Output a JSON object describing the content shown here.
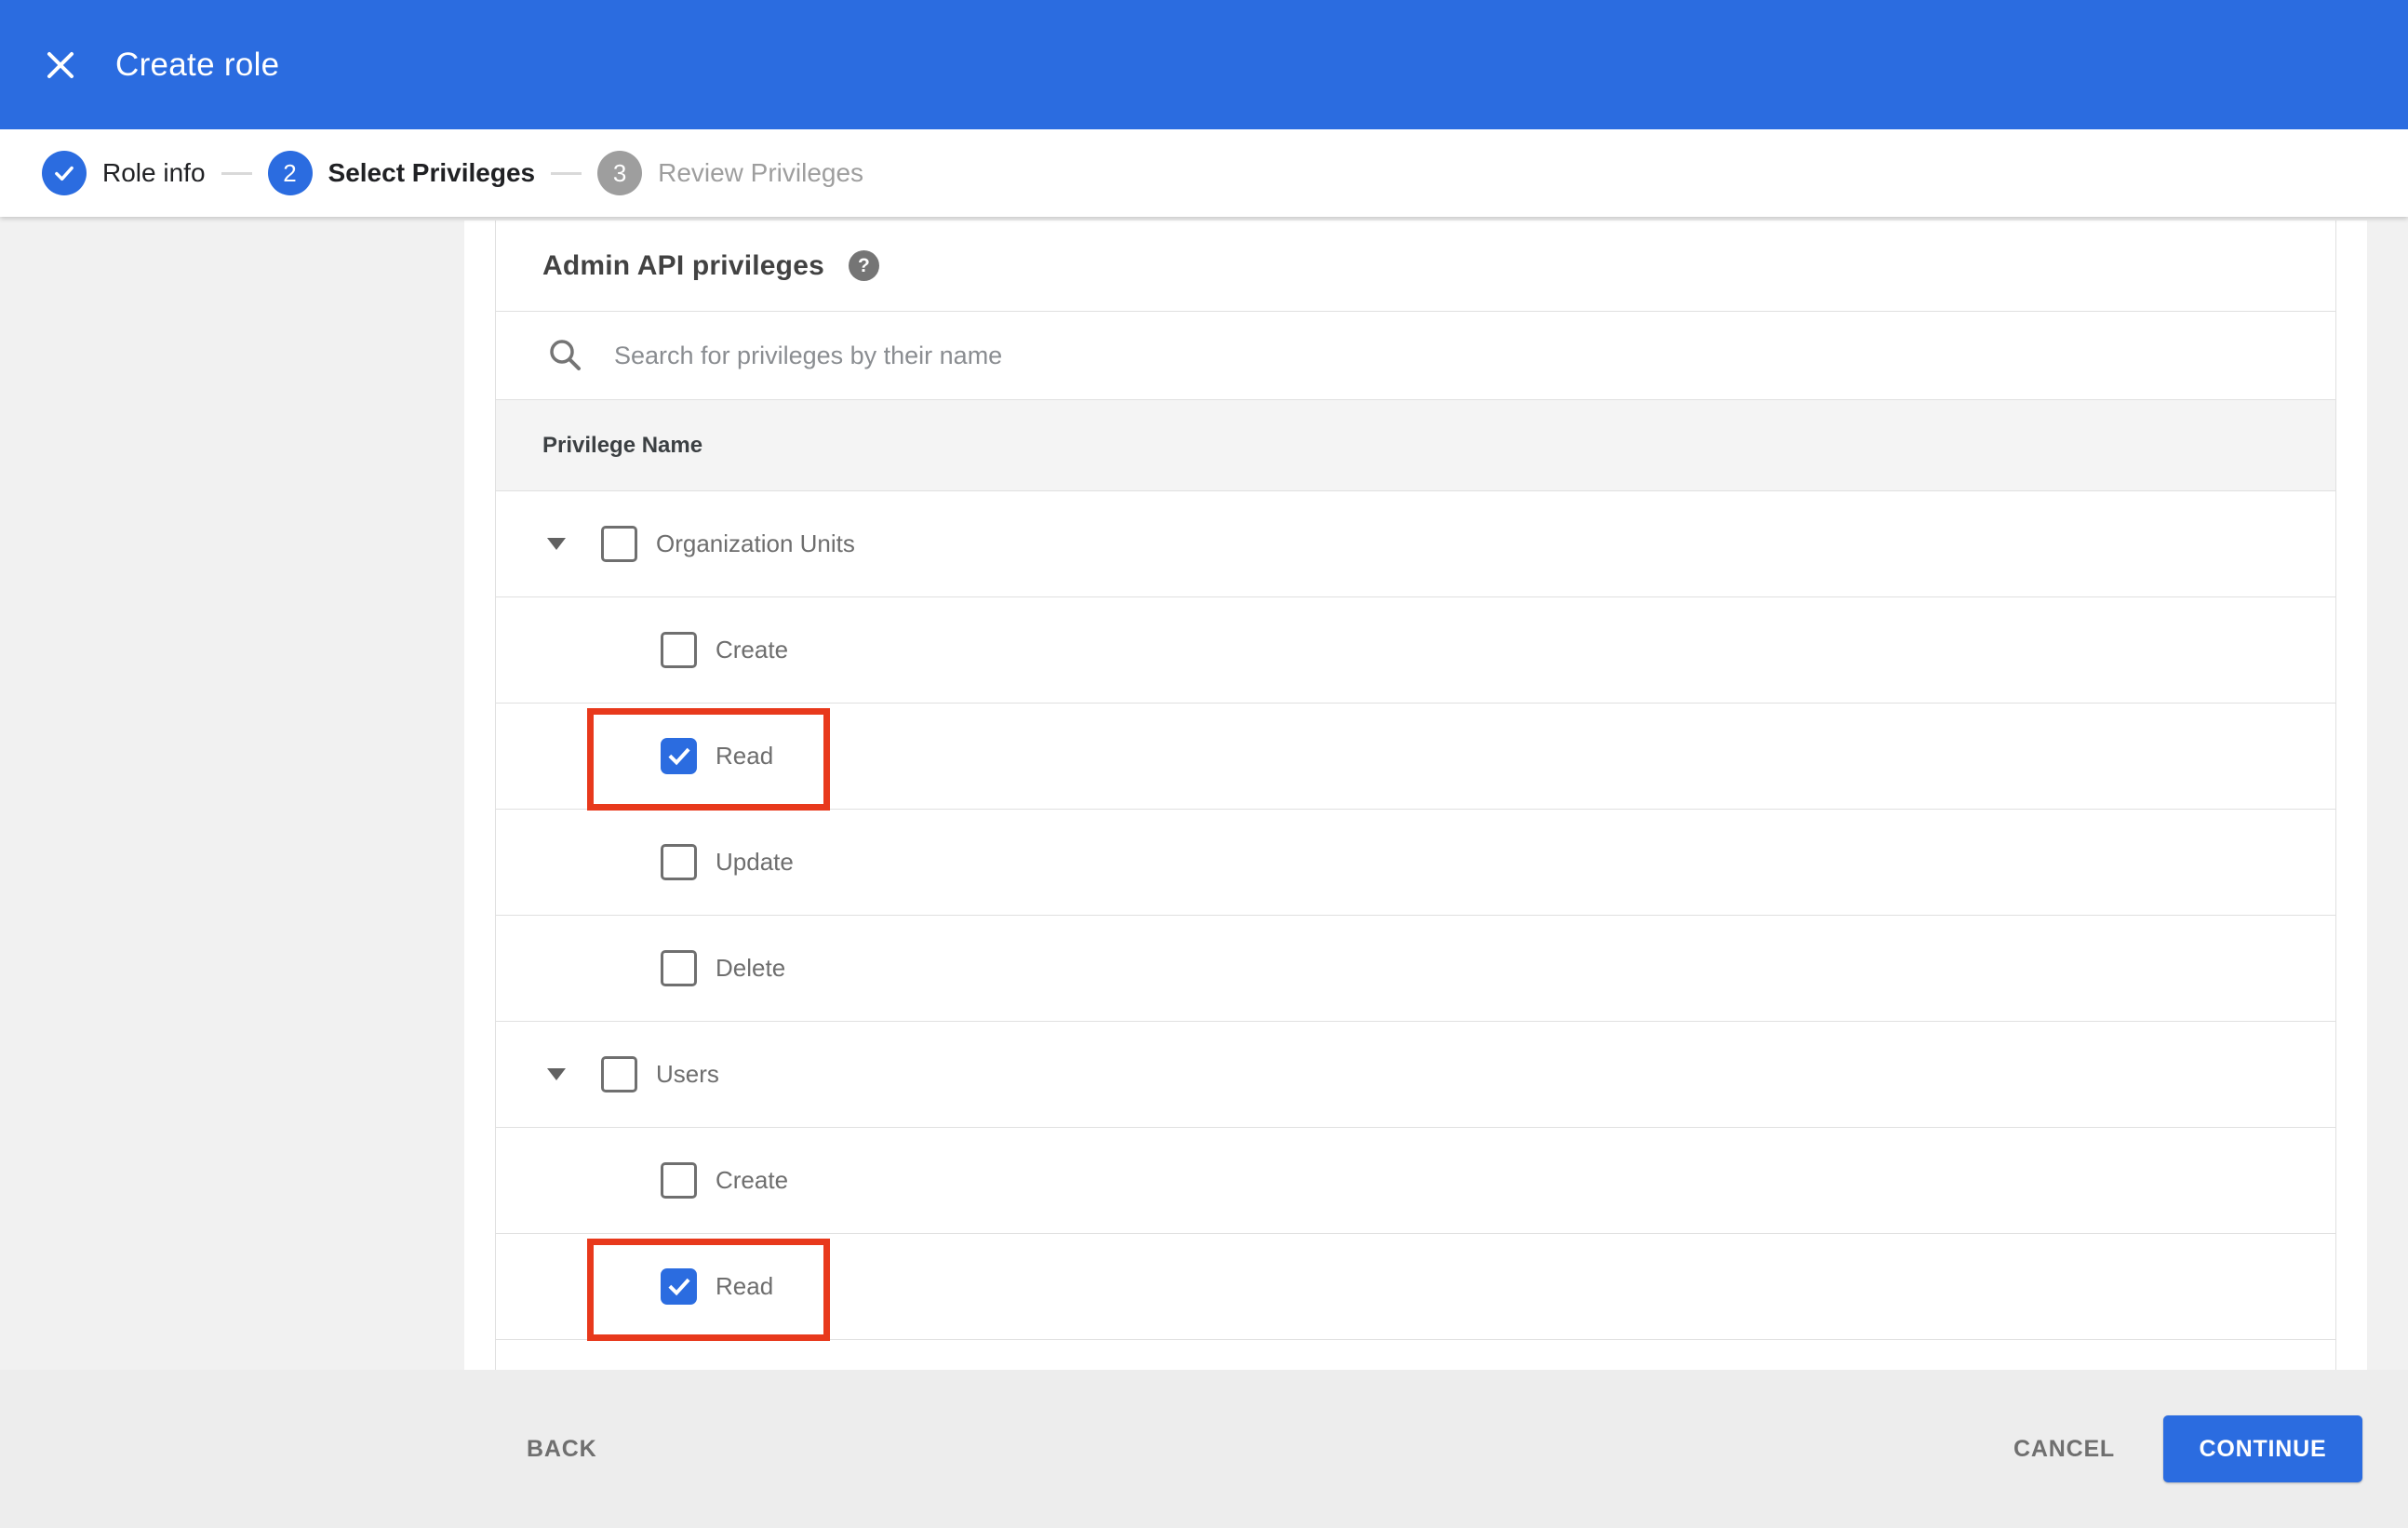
{
  "appbar": {
    "title": "Create role",
    "color": "#2b6ce0"
  },
  "stepper": {
    "steps": [
      {
        "indicator": "check",
        "label": "Role info",
        "state": "completed"
      },
      {
        "indicator": "2",
        "label": "Select Privileges",
        "state": "active"
      },
      {
        "indicator": "3",
        "label": "Review Privileges",
        "state": "upcoming"
      }
    ]
  },
  "panel": {
    "heading": "Admin API privileges",
    "help_glyph": "?",
    "search": {
      "placeholder": "Search for privileges by their name",
      "icon": "magnifier"
    },
    "table": {
      "header": "Privilege Name",
      "rows": [
        {
          "label": "Organization Units",
          "level": "group",
          "checked": false,
          "expanded": true,
          "highlighted": false
        },
        {
          "label": "Create",
          "level": "child",
          "checked": false,
          "highlighted": false
        },
        {
          "label": "Read",
          "level": "child",
          "checked": true,
          "highlighted": true
        },
        {
          "label": "Update",
          "level": "child",
          "checked": false,
          "highlighted": false
        },
        {
          "label": "Delete",
          "level": "child",
          "checked": false,
          "highlighted": false
        },
        {
          "label": "Users",
          "level": "group",
          "checked": false,
          "expanded": true,
          "highlighted": false
        },
        {
          "label": "Create",
          "level": "child",
          "checked": false,
          "highlighted": false
        },
        {
          "label": "Read",
          "level": "child",
          "checked": true,
          "highlighted": true
        }
      ]
    }
  },
  "footer": {
    "back_label": "BACK",
    "cancel_label": "CANCEL",
    "continue_label": "CONTINUE"
  },
  "colors": {
    "primary_blue": "#2b6ce0",
    "highlight_red": "#e8391c",
    "step_inactive_gray": "#9e9e9e"
  }
}
